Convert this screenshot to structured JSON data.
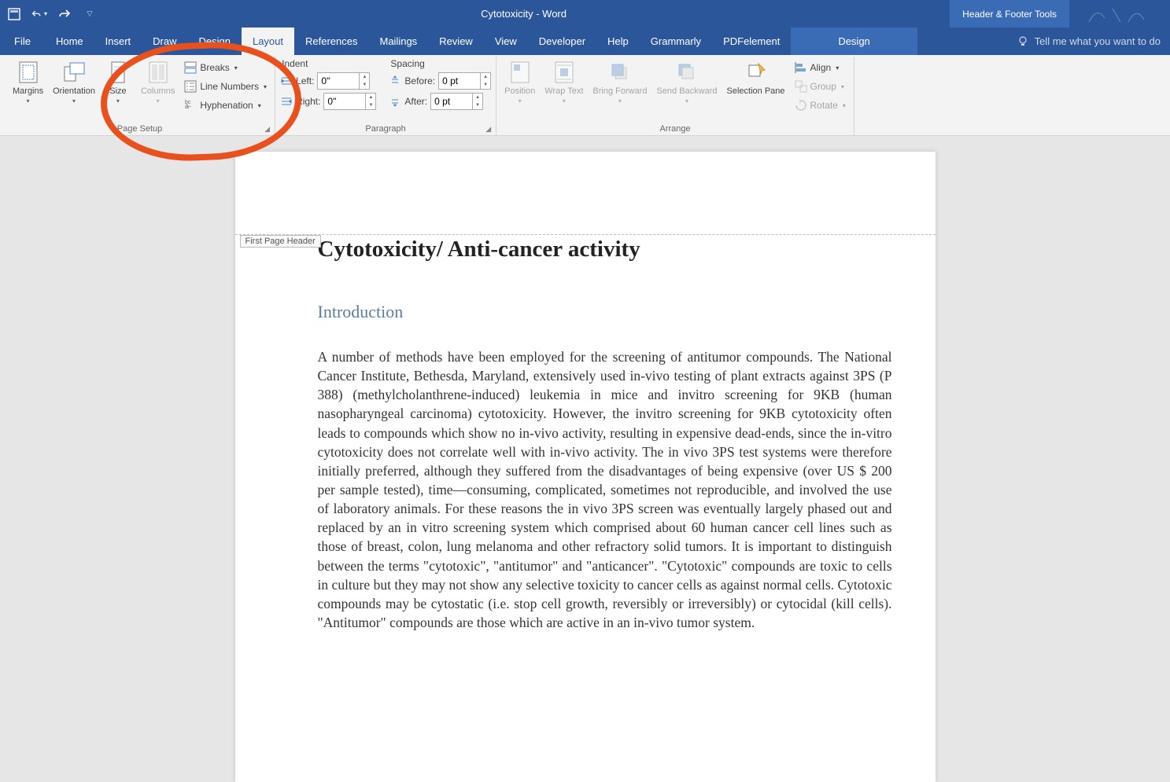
{
  "titlebar": {
    "doc_title": "Cytotoxicity  -  Word",
    "hf_tools_label": "Header & Footer Tools"
  },
  "tabs": {
    "file": "File",
    "home": "Home",
    "insert": "Insert",
    "draw": "Draw",
    "design": "Design",
    "layout": "Layout",
    "references": "References",
    "mailings": "Mailings",
    "review": "Review",
    "view": "View",
    "developer": "Developer",
    "help": "Help",
    "grammarly": "Grammarly",
    "pdfelement": "PDFelement",
    "contextual_design": "Design",
    "tell_me": "Tell me what you want to do"
  },
  "page_setup": {
    "margins": "Margins",
    "orientation": "Orientation",
    "size": "Size",
    "columns": "Columns",
    "breaks": "Breaks",
    "line_numbers": "Line Numbers",
    "hyphenation": "Hyphenation",
    "group_label": "Page Setup"
  },
  "paragraph": {
    "indent_label": "Indent",
    "spacing_label": "Spacing",
    "left_label": "Left:",
    "right_label": "Right:",
    "before_label": "Before:",
    "after_label": "After:",
    "left_value": "0\"",
    "right_value": "0\"",
    "before_value": "0 pt",
    "after_value": "0 pt",
    "group_label": "Paragraph"
  },
  "arrange": {
    "position": "Position",
    "wrap_text": "Wrap Text",
    "bring_forward": "Bring Forward",
    "send_backward": "Send Backward",
    "selection_pane": "Selection Pane",
    "align": "Align",
    "group_cmd": "Group",
    "rotate": "Rotate",
    "group_label": "Arrange"
  },
  "document": {
    "header_tag": "First Page Header",
    "title": "Cytotoxicity/ Anti-cancer activity",
    "h2": "Introduction",
    "body": "A number of methods have been employed for the screening of antitumor compounds. The National Cancer Institute, Bethesda, Maryland, extensively used in-vivo testing of plant extracts against 3PS (P 388) (methylcholanthrene-induced) leukemia in mice and invitro screening for 9KB (human nasopharyngeal carcinoma) cytotoxicity. However, the invitro screening for 9KB cytotoxicity often leads to compounds which show no in-vivo activity, resulting in expensive dead-ends, since the in-vitro cytotoxicity does not correlate well with in-vivo activity. The in vivo 3PS test systems were therefore initially preferred, although they suffered from the disadvantages of being expensive (over US $ 200 per sample tested), time—consuming, complicated, sometimes not reproducible, and involved the use of laboratory animals. For these reasons the in vivo 3PS screen was eventually largely phased out and replaced by an in vitro screening system which comprised about 60 human cancer cell lines such as those of breast, colon, lung melanoma and other refractory solid tumors.  It is important to distinguish between the terms \"cytotoxic\", \"antitumor\" and \"anticancer\". \"Cytotoxic\" compounds are toxic to cells in culture but they may not show any selective toxicity to cancer cells as against normal cells. Cytotoxic compounds may be cytostatic (i.e. stop cell growth, reversibly or irreversibly) or cytocidal (kill cells). \"Antitumor\" compounds are those which are active in an in-vivo tumor system."
  }
}
